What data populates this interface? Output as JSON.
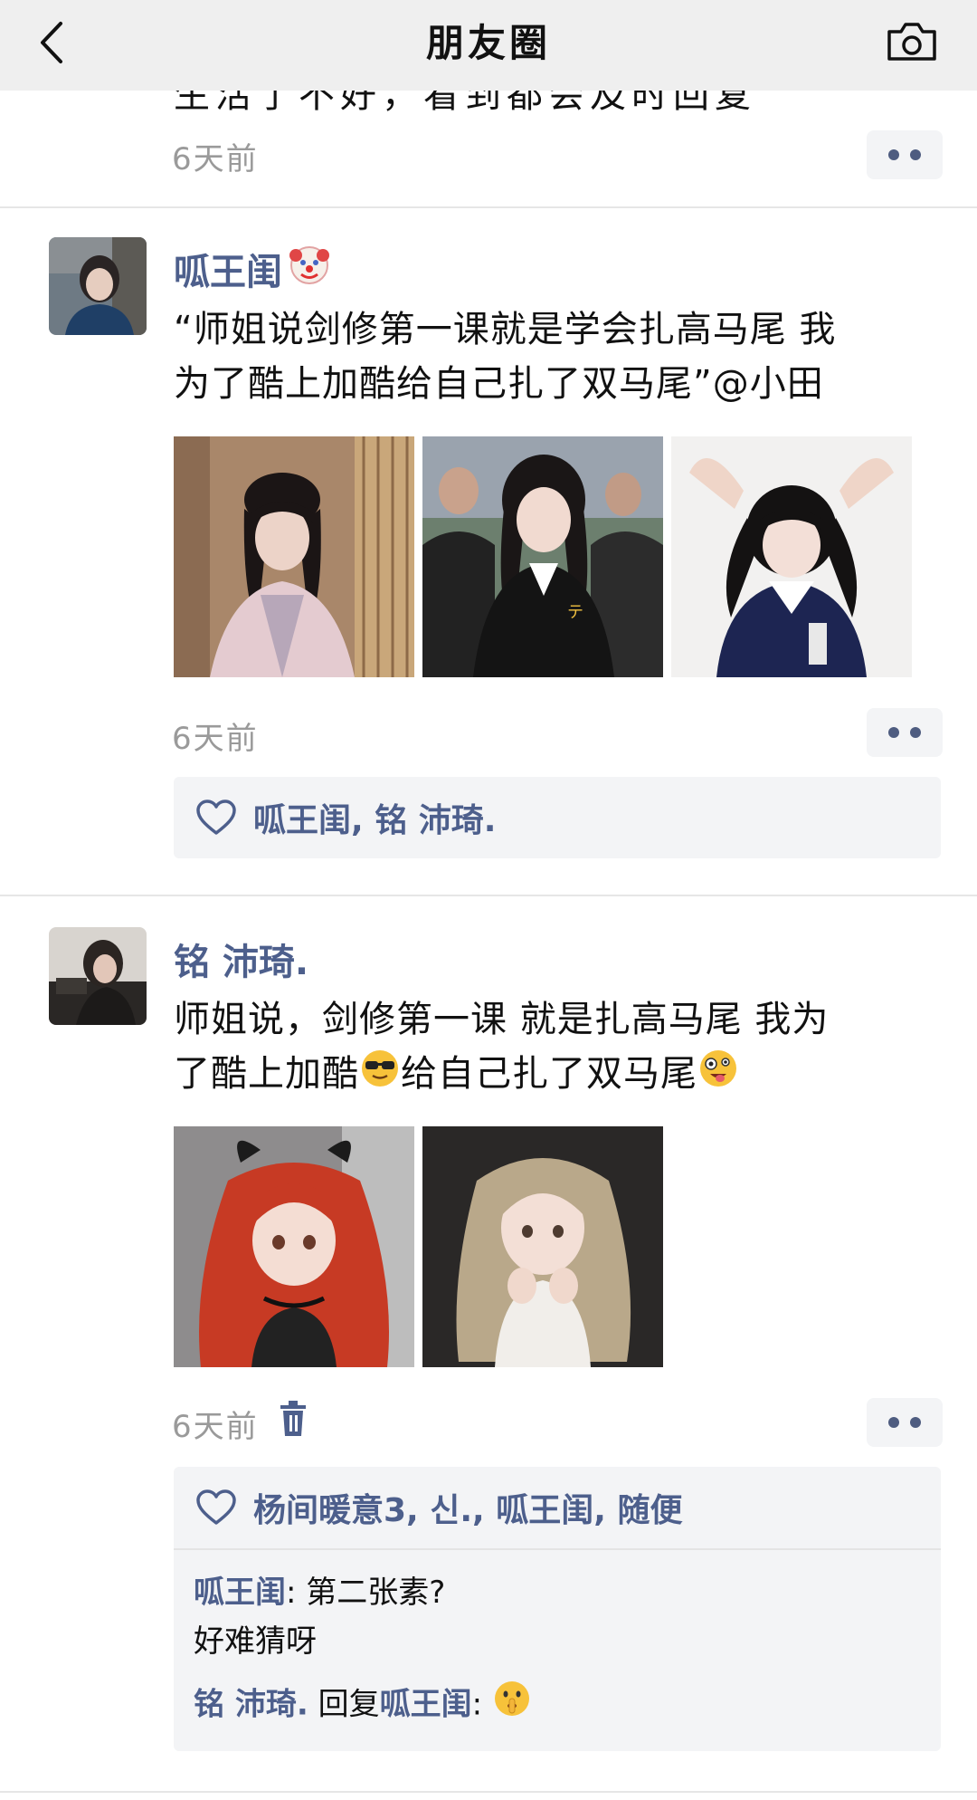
{
  "header": {
    "title": "朋友圈",
    "back_icon": "chevron-left-icon",
    "camera_icon": "camera-icon"
  },
  "prev_post": {
    "cut_text": "生活了不好，看到都会及时回复",
    "time": "6天前"
  },
  "post1": {
    "author": "呱王闺",
    "text_line1": "“师姐说剑修第一课就是学会扎高马尾 我",
    "text_line2": "为了酷上加酷给自己扎了双马尾”@小田",
    "time": "6天前",
    "likes": "呱王闺, 铭 沛琦."
  },
  "post2": {
    "author": "铭 沛琦.",
    "text_line1": "师姐说，剑修第一课 就是扎高马尾 我为",
    "text_line2": "了酷上加酷",
    "text_line2b": "给自己扎了双马尾",
    "time": "6天前",
    "likes": "杨间暖意3, 신., 呱王闺, 随便",
    "comments": [
      {
        "name": "呱王闺",
        "sep": ": ",
        "text": "第二张素?"
      },
      {
        "text": "好难猜呀"
      },
      {
        "name": "铭 沛琦.",
        "mid": " 回复",
        "name2": "呱王闺",
        "sep": ": "
      }
    ]
  },
  "colors": {
    "name": "#4d5f8c",
    "time": "#9a9a9a",
    "header_bg": "#efefef",
    "likes_bg": "#f3f4f6"
  }
}
